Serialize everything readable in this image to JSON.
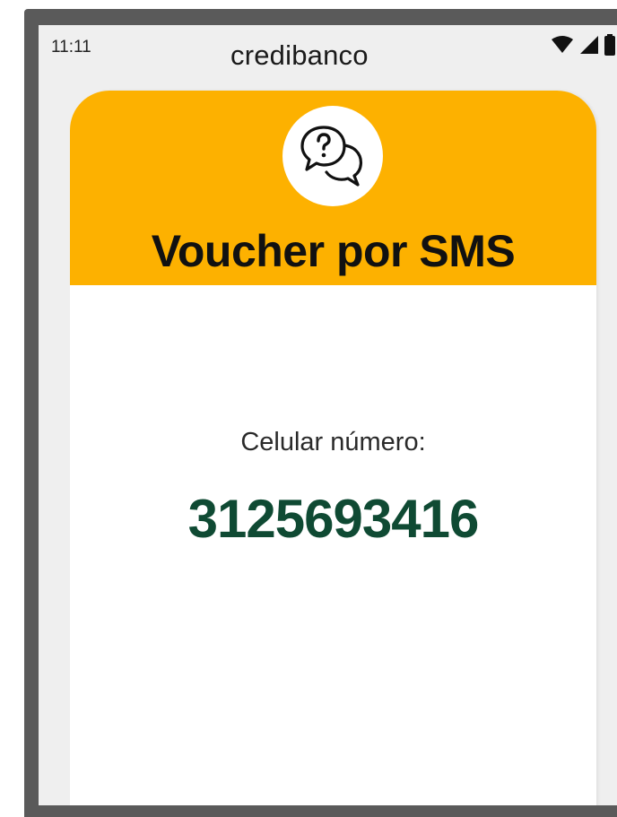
{
  "status_bar": {
    "time": "11:11",
    "icons": [
      "wifi-icon",
      "signal-icon",
      "battery-icon"
    ]
  },
  "brand": {
    "name": "credibanco",
    "accent_color": "#00b5c7"
  },
  "header": {
    "icon": "chat-question-icon",
    "title": "Voucher por SMS",
    "background_color": "#fdb100"
  },
  "content": {
    "phone_label": "Celular número:",
    "phone_number": "3125693416",
    "phone_number_color": "#0f4a33"
  }
}
